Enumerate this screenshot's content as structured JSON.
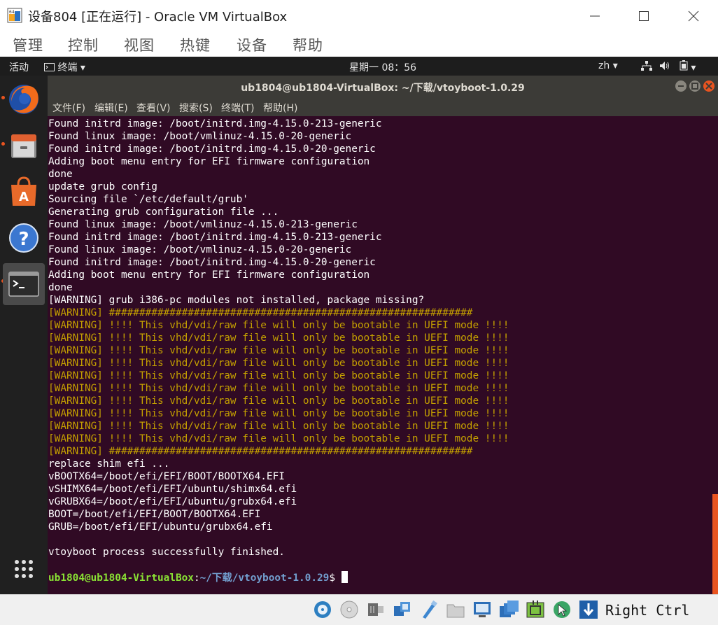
{
  "window": {
    "title": "设备804 [正在运行] - Oracle VM VirtualBox"
  },
  "vbox_menu": [
    "管理",
    "控制",
    "视图",
    "热键",
    "设备",
    "帮助"
  ],
  "gnome_topbar": {
    "activities": "活动",
    "app_menu": "终端",
    "clock": "星期一 08：56",
    "input_method": "zh"
  },
  "dock": {
    "items": [
      "firefox-icon",
      "files-icon",
      "software-center-icon",
      "help-icon",
      "terminal-icon",
      "show-apps-icon"
    ]
  },
  "terminal": {
    "title": "ub1804@ub1804-VirtualBox: ~/下载/vtoyboot-1.0.29",
    "menu": [
      "文件(F)",
      "编辑(E)",
      "查看(V)",
      "搜索(S)",
      "终端(T)",
      "帮助(H)"
    ],
    "lines": [
      "Found initrd image: /boot/initrd.img-4.15.0-213-generic",
      "Found linux image: /boot/vmlinuz-4.15.0-20-generic",
      "Found initrd image: /boot/initrd.img-4.15.0-20-generic",
      "Adding boot menu entry for EFI firmware configuration",
      "done",
      "update grub config",
      "Sourcing file `/etc/default/grub'",
      "Generating grub configuration file ...",
      "Found linux image: /boot/vmlinuz-4.15.0-213-generic",
      "Found initrd image: /boot/initrd.img-4.15.0-213-generic",
      "Found linux image: /boot/vmlinuz-4.15.0-20-generic",
      "Found initrd image: /boot/initrd.img-4.15.0-20-generic",
      "Adding boot menu entry for EFI firmware configuration",
      "done",
      "[WARNING] grub i386-pc modules not installed, package missing?",
      "[WARNING] ############################################################",
      "[WARNING] !!!! This vhd/vdi/raw file will only be bootable in UEFI mode !!!!",
      "[WARNING] !!!! This vhd/vdi/raw file will only be bootable in UEFI mode !!!!",
      "[WARNING] !!!! This vhd/vdi/raw file will only be bootable in UEFI mode !!!!",
      "[WARNING] !!!! This vhd/vdi/raw file will only be bootable in UEFI mode !!!!",
      "[WARNING] !!!! This vhd/vdi/raw file will only be bootable in UEFI mode !!!!",
      "[WARNING] !!!! This vhd/vdi/raw file will only be bootable in UEFI mode !!!!",
      "[WARNING] !!!! This vhd/vdi/raw file will only be bootable in UEFI mode !!!!",
      "[WARNING] !!!! This vhd/vdi/raw file will only be bootable in UEFI mode !!!!",
      "[WARNING] !!!! This vhd/vdi/raw file will only be bootable in UEFI mode !!!!",
      "[WARNING] !!!! This vhd/vdi/raw file will only be bootable in UEFI mode !!!!",
      "[WARNING] ############################################################",
      "replace shim efi ...",
      "vBOOTX64=/boot/efi/EFI/BOOT/BOOTX64.EFI",
      "vSHIMX64=/boot/efi/EFI/ubuntu/shimx64.efi",
      "vGRUBX64=/boot/efi/EFI/ubuntu/grubx64.efi",
      "BOOT=/boot/efi/EFI/BOOT/BOOTX64.EFI",
      "GRUB=/boot/efi/EFI/ubuntu/grubx64.efi",
      "",
      "vtoyboot process successfully finished.",
      ""
    ],
    "prompt_user": "ub1804@ub1804-VirtualBox",
    "prompt_sep": ":",
    "prompt_path": "~/下载/vtoyboot-1.0.29",
    "prompt_symbol": "$ "
  },
  "statusbar": {
    "host_key": "Right Ctrl"
  },
  "colors": {
    "terminal_bg": "#300a24",
    "warning_text": "#c4a000",
    "prompt_user": "#8ae234",
    "prompt_path": "#729fcf",
    "accent": "#e95420"
  }
}
